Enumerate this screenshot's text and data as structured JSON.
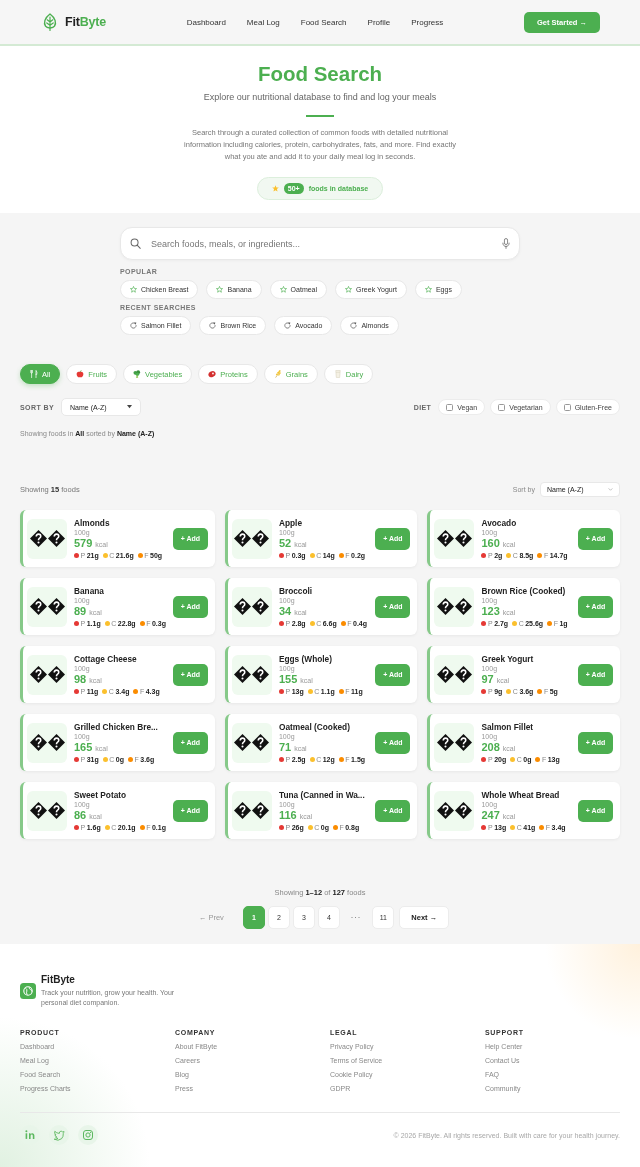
{
  "header": {
    "brand": [
      "Fit",
      "Byte"
    ],
    "nav": [
      "Dashboard",
      "Meal Log",
      "Food Search",
      "Profile",
      "Progress"
    ],
    "cta": "Get Started →"
  },
  "hero": {
    "title": "Food Search",
    "subtitle": "Explore our nutritional database to find and log your meals",
    "description": "Search through a curated collection of common foods with detailed nutritional information including calories, protein, carbohydrates, fats, and more. Find exactly what you ate and add it to your daily meal log in seconds.",
    "badge": {
      "count": "50+",
      "label": "foods in database"
    }
  },
  "search": {
    "placeholder": "Search foods, meals, or ingredients...",
    "popular_label": "POPULAR",
    "popular": [
      "Chicken Breast",
      "Banana",
      "Oatmeal",
      "Greek Yogurt",
      "Eggs"
    ],
    "recent_label": "RECENT SEARCHES",
    "recent": [
      "Salmon Fillet",
      "Brown Rice",
      "Avocado",
      "Almonds"
    ]
  },
  "categories": [
    {
      "label": "All",
      "selected": true
    },
    {
      "label": "Fruits",
      "selected": false
    },
    {
      "label": "Vegetables",
      "selected": false
    },
    {
      "label": "Proteins",
      "selected": false
    },
    {
      "label": "Grains",
      "selected": false
    },
    {
      "label": "Dairy",
      "selected": false
    }
  ],
  "filters": {
    "sort_label": "SORT BY",
    "sort_value": "Name (A-Z)",
    "diet_label": "DIET",
    "diets": [
      {
        "label": "Vegan",
        "checked": false
      },
      {
        "label": "Vegetarian",
        "checked": false
      },
      {
        "label": "Gluten-Free",
        "checked": false
      }
    ]
  },
  "summary": "Showing foods in **All** sorted by **Name (A-Z)**",
  "results": {
    "count_text": "Showing **15** foods",
    "sort_label": "Sort by",
    "sort_value": "Name (A-Z)",
    "foods": [
      {
        "name": "Almonds",
        "serving": "100g",
        "calories": "579",
        "unit": "kcal",
        "action": "+ Add",
        "macros": [
          {
            "label": "P",
            "value": "21g",
            "color": "#e53935"
          },
          {
            "label": "C",
            "value": "21.6g",
            "color": "#fbc02d"
          },
          {
            "label": "F",
            "value": "50g",
            "color": "#fb8c00"
          }
        ]
      },
      {
        "name": "Apple",
        "serving": "100g",
        "calories": "52",
        "unit": "kcal",
        "action": "+ Add",
        "macros": [
          {
            "label": "P",
            "value": "0.3g",
            "color": "#e53935"
          },
          {
            "label": "C",
            "value": "14g",
            "color": "#fbc02d"
          },
          {
            "label": "F",
            "value": "0.2g",
            "color": "#fb8c00"
          }
        ]
      },
      {
        "name": "Avocado",
        "serving": "100g",
        "calories": "160",
        "unit": "kcal",
        "action": "+ Add",
        "macros": [
          {
            "label": "P",
            "value": "2g",
            "color": "#e53935"
          },
          {
            "label": "C",
            "value": "8.5g",
            "color": "#fbc02d"
          },
          {
            "label": "F",
            "value": "14.7g",
            "color": "#fb8c00"
          }
        ]
      },
      {
        "name": "Banana",
        "serving": "100g",
        "calories": "89",
        "unit": "kcal",
        "action": "+ Add",
        "macros": [
          {
            "label": "P",
            "value": "1.1g",
            "color": "#e53935"
          },
          {
            "label": "C",
            "value": "22.8g",
            "color": "#fbc02d"
          },
          {
            "label": "F",
            "value": "0.3g",
            "color": "#fb8c00"
          }
        ]
      },
      {
        "name": "Broccoli",
        "serving": "100g",
        "calories": "34",
        "unit": "kcal",
        "action": "+ Add",
        "macros": [
          {
            "label": "P",
            "value": "2.8g",
            "color": "#e53935"
          },
          {
            "label": "C",
            "value": "6.6g",
            "color": "#fbc02d"
          },
          {
            "label": "F",
            "value": "0.4g",
            "color": "#fb8c00"
          }
        ]
      },
      {
        "name": "Brown Rice (Cooked)",
        "serving": "100g",
        "calories": "123",
        "unit": "kcal",
        "action": "+ Add",
        "macros": [
          {
            "label": "P",
            "value": "2.7g",
            "color": "#e53935"
          },
          {
            "label": "C",
            "value": "25.6g",
            "color": "#fbc02d"
          },
          {
            "label": "F",
            "value": "1g",
            "color": "#fb8c00"
          }
        ]
      },
      {
        "name": "Cottage Cheese",
        "serving": "100g",
        "calories": "98",
        "unit": "kcal",
        "action": "+ Add",
        "macros": [
          {
            "label": "P",
            "value": "11g",
            "color": "#e53935"
          },
          {
            "label": "C",
            "value": "3.4g",
            "color": "#fbc02d"
          },
          {
            "label": "F",
            "value": "4.3g",
            "color": "#fb8c00"
          }
        ]
      },
      {
        "name": "Eggs (Whole)",
        "serving": "100g",
        "calories": "155",
        "unit": "kcal",
        "action": "+ Add",
        "macros": [
          {
            "label": "P",
            "value": "13g",
            "color": "#e53935"
          },
          {
            "label": "C",
            "value": "1.1g",
            "color": "#fbc02d"
          },
          {
            "label": "F",
            "value": "11g",
            "color": "#fb8c00"
          }
        ]
      },
      {
        "name": "Greek Yogurt",
        "serving": "100g",
        "calories": "97",
        "unit": "kcal",
        "action": "+ Add",
        "macros": [
          {
            "label": "P",
            "value": "9g",
            "color": "#e53935"
          },
          {
            "label": "C",
            "value": "3.6g",
            "color": "#fbc02d"
          },
          {
            "label": "F",
            "value": "5g",
            "color": "#fb8c00"
          }
        ]
      },
      {
        "name": "Grilled Chicken Bre...",
        "serving": "100g",
        "calories": "165",
        "unit": "kcal",
        "action": "+ Add",
        "macros": [
          {
            "label": "P",
            "value": "31g",
            "color": "#e53935"
          },
          {
            "label": "C",
            "value": "0g",
            "color": "#fbc02d"
          },
          {
            "label": "F",
            "value": "3.6g",
            "color": "#fb8c00"
          }
        ]
      },
      {
        "name": "Oatmeal (Cooked)",
        "serving": "100g",
        "calories": "71",
        "unit": "kcal",
        "action": "+ Add",
        "macros": [
          {
            "label": "P",
            "value": "2.5g",
            "color": "#e53935"
          },
          {
            "label": "C",
            "value": "12g",
            "color": "#fbc02d"
          },
          {
            "label": "F",
            "value": "1.5g",
            "color": "#fb8c00"
          }
        ]
      },
      {
        "name": "Salmon Fillet",
        "serving": "100g",
        "calories": "208",
        "unit": "kcal",
        "action": "+ Add",
        "macros": [
          {
            "label": "P",
            "value": "20g",
            "color": "#e53935"
          },
          {
            "label": "C",
            "value": "0g",
            "color": "#fbc02d"
          },
          {
            "label": "F",
            "value": "13g",
            "color": "#fb8c00"
          }
        ]
      },
      {
        "name": "Sweet Potato",
        "serving": "100g",
        "calories": "86",
        "unit": "kcal",
        "action": "+ Add",
        "macros": [
          {
            "label": "P",
            "value": "1.6g",
            "color": "#e53935"
          },
          {
            "label": "C",
            "value": "20.1g",
            "color": "#fbc02d"
          },
          {
            "label": "F",
            "value": "0.1g",
            "color": "#fb8c00"
          }
        ]
      },
      {
        "name": "Tuna (Canned in Wa...",
        "serving": "100g",
        "calories": "116",
        "unit": "kcal",
        "action": "+ Add",
        "macros": [
          {
            "label": "P",
            "value": "26g",
            "color": "#e53935"
          },
          {
            "label": "C",
            "value": "0g",
            "color": "#fbc02d"
          },
          {
            "label": "F",
            "value": "0.8g",
            "color": "#fb8c00"
          }
        ]
      },
      {
        "name": "Whole Wheat Bread",
        "serving": "100g",
        "calories": "247",
        "unit": "kcal",
        "action": "+ Add",
        "macros": [
          {
            "label": "P",
            "value": "13g",
            "color": "#e53935"
          },
          {
            "label": "C",
            "value": "41g",
            "color": "#fbc02d"
          },
          {
            "label": "F",
            "value": "3.4g",
            "color": "#fb8c00"
          }
        ]
      }
    ]
  },
  "pagination": {
    "summary": "Showing **1–12** of **127** foods",
    "prev": {
      "label": "← Prev",
      "disabled": true
    },
    "items": [
      {
        "kind": "page",
        "label": "1",
        "selected": true
      },
      {
        "kind": "page",
        "label": "2",
        "selected": false
      },
      {
        "kind": "page",
        "label": "3",
        "selected": false
      },
      {
        "kind": "page",
        "label": "4",
        "selected": false
      },
      {
        "kind": "gap",
        "label": "···"
      },
      {
        "kind": "page",
        "label": "11",
        "selected": false
      }
    ],
    "next": {
      "label": "Next →",
      "disabled": false
    }
  },
  "footer": {
    "brand": "FitByte",
    "tagline": "Track your nutrition, grow your health. Your personal diet companion.",
    "columns": [
      {
        "heading": "PRODUCT",
        "links": [
          "Dashboard",
          "Meal Log",
          "Food Search",
          "Progress Charts"
        ]
      },
      {
        "heading": "COMPANY",
        "links": [
          "About FitByte",
          "Careers",
          "Blog",
          "Press"
        ]
      },
      {
        "heading": "LEGAL",
        "links": [
          "Privacy Policy",
          "Terms of Service",
          "Cookie Policy",
          "GDPR"
        ]
      },
      {
        "heading": "SUPPORT",
        "links": [
          "Help Center",
          "Contact Us",
          "FAQ",
          "Community"
        ]
      }
    ],
    "copyright": "© 2026 FitByte. All rights reserved. Built with care for your health journey."
  }
}
